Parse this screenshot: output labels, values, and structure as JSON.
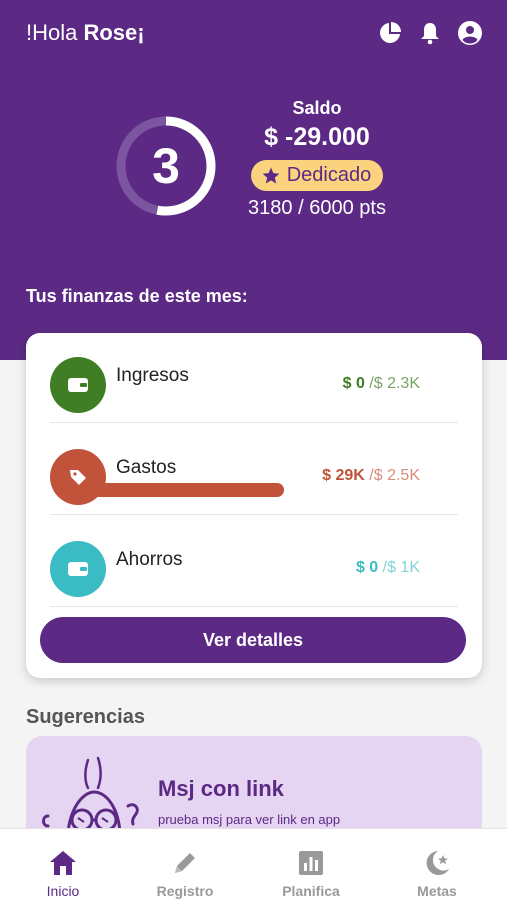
{
  "header": {
    "greeting": "!Hola",
    "name": "Rose¡"
  },
  "level": {
    "number": "3",
    "progress": 0.53
  },
  "balance": {
    "label": "Saldo",
    "value": "$ -29.000",
    "badge_label": "Dedicado",
    "points": "3180 / 6000 pts"
  },
  "month_title": "Tus finanzas de este mes:",
  "finances": [
    {
      "name": "Ingresos",
      "spent": "$ 0",
      "budget": " /$ 2.3K",
      "color": "#3f7e24",
      "icon": "wallet-icon",
      "progress": 0
    },
    {
      "name": "Gastos",
      "spent": "$ 29K",
      "budget": " /$ 2.5K",
      "color": "#c1533a",
      "icon": "price-tag-icon",
      "progress": 1
    },
    {
      "name": "Ahorros",
      "spent": "$ 0",
      "budget": " /$ 1K",
      "color": "#3bbcc4",
      "icon": "wallet-icon",
      "progress": 0
    }
  ],
  "details_button": "Ver detalles",
  "suggestions": {
    "title": "Sugerencias",
    "card_title": "Msj con link",
    "card_subtitle": "prueba msj para ver link en app"
  },
  "nav": [
    {
      "label": "Inicio",
      "icon": "home-icon",
      "active": true
    },
    {
      "label": "Registro",
      "icon": "pencil-icon",
      "active": false
    },
    {
      "label": "Planifica",
      "icon": "bar-chart-icon",
      "active": false
    },
    {
      "label": "Metas",
      "icon": "moon-star-icon",
      "active": false
    }
  ],
  "colors": {
    "primary": "#5c2a85",
    "badge": "#fbd27e",
    "income": "#3f7e24",
    "expense": "#c1533a",
    "savings": "#3bbcc4",
    "suggestion_bg": "#e6d4f3"
  }
}
